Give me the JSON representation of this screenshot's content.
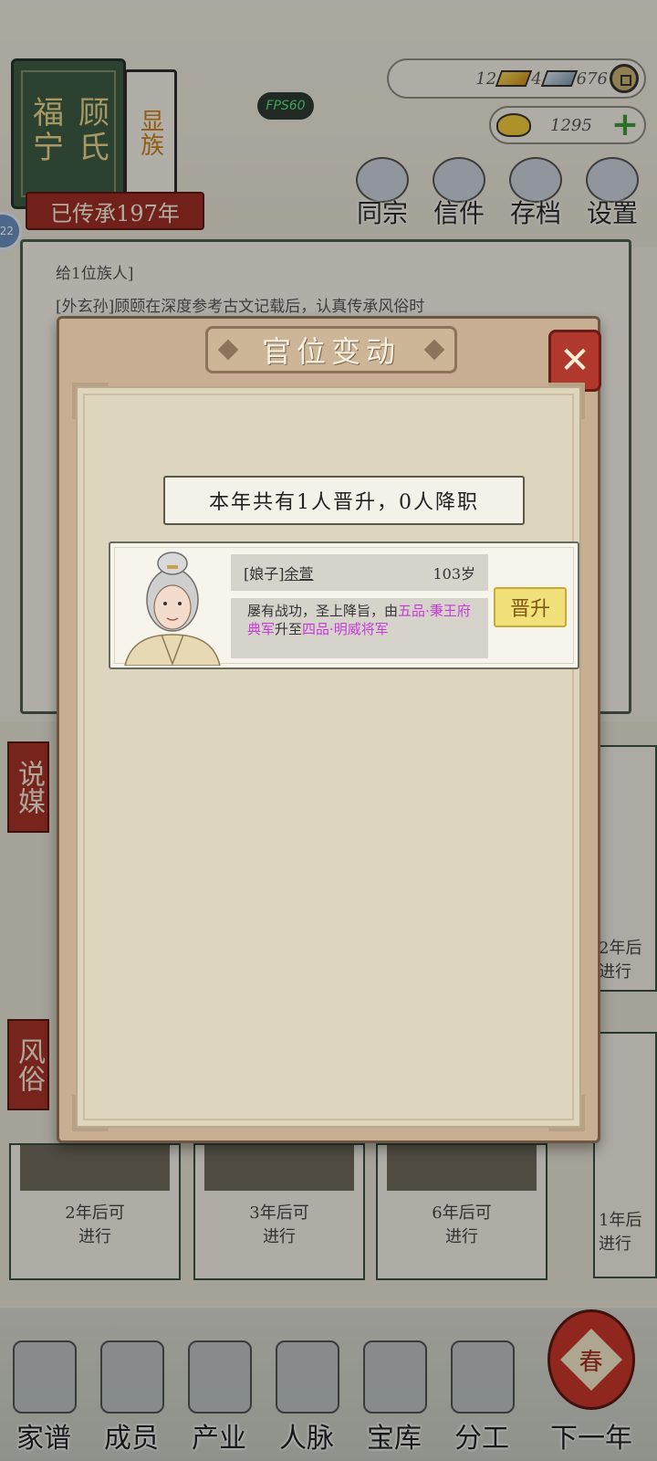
{
  "clan": {
    "place": "福宁",
    "surname": "顾氏",
    "rank": "显族",
    "heritage": "已传承197年"
  },
  "side_badge": "22",
  "fps": "FPS60",
  "resources": {
    "gold_count": "12",
    "silver_count": "4",
    "copper_count": "676",
    "ingot_count": "1295"
  },
  "top_menu": [
    {
      "label": "同宗",
      "icon": "clan-books-icon"
    },
    {
      "label": "信件",
      "icon": "letter-icon"
    },
    {
      "label": "存档",
      "icon": "scroll-brush-icon"
    },
    {
      "label": "设置",
      "icon": "gear-icon"
    }
  ],
  "log": {
    "line1": "给1位族人]",
    "line2": "[外玄孙]顾颐在深度参考古文记载后，认真传承风俗时"
  },
  "side_labels": {
    "matchmaking": "说媒",
    "custom": "风俗"
  },
  "cards": [
    {
      "text1": "2年后可",
      "text2": "进行"
    },
    {
      "text1": "3年后可",
      "text2": "进行"
    },
    {
      "text1": "6年后可",
      "text2": "进行"
    }
  ],
  "right_cards": {
    "upper": {
      "text1": "2年后",
      "text2": "进行"
    },
    "lower": {
      "text1": "1年后",
      "text2": "进行"
    }
  },
  "nav": [
    {
      "label": "家谱"
    },
    {
      "label": "成员"
    },
    {
      "label": "产业"
    },
    {
      "label": "人脉"
    },
    {
      "label": "宝库"
    },
    {
      "label": "分工"
    },
    {
      "label": "下一年",
      "lantern": "春"
    }
  ],
  "modal": {
    "title": "官位变动",
    "close": "✕",
    "summary": "本年共有1人晋升，0人降职",
    "records": [
      {
        "title": "[娘子]",
        "name": "余萱",
        "age": "103岁",
        "desc_pre": "屡有战功，圣上降旨，由",
        "from": "五品·秉王府典军",
        "desc_mid": "升至",
        "to": "四品·明威将军",
        "status": "晋升"
      }
    ]
  },
  "colors": {
    "highlight": "#c63bd8",
    "promotion_btn": "#f2e07a",
    "close_btn": "#b1382c"
  }
}
